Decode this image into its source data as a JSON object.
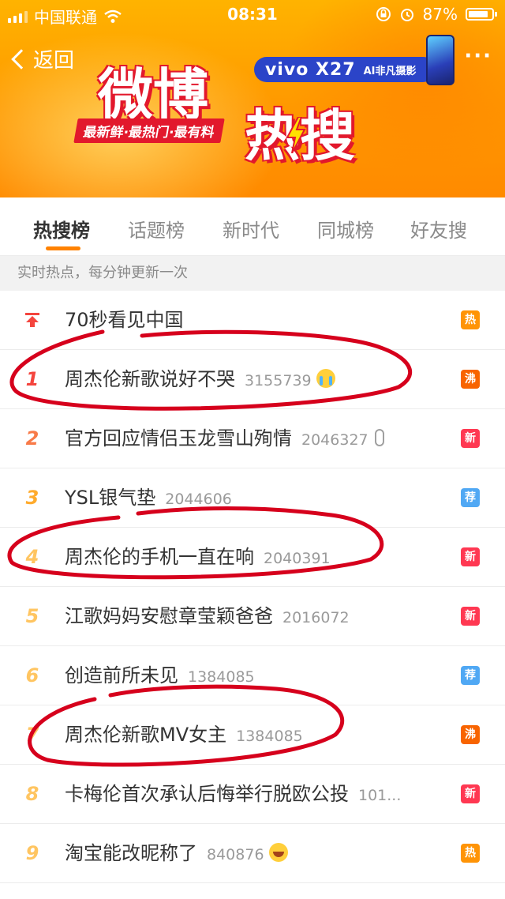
{
  "status_bar": {
    "carrier": "中国联通",
    "time": "08:31",
    "battery": "87%",
    "battery_level": 0.87
  },
  "nav": {
    "back_label": "返回",
    "more_label": "···"
  },
  "banner": {
    "logo_part1": "微博",
    "logo_part2": "热搜",
    "slogan": "最新鲜·最热门·最有料",
    "ad_brand": "vivo X27",
    "ad_tag": "AI非凡摄影"
  },
  "tabs": [
    {
      "label": "热搜榜",
      "active": true
    },
    {
      "label": "话题榜",
      "active": false
    },
    {
      "label": "新时代",
      "active": false
    },
    {
      "label": "同城榜",
      "active": false
    },
    {
      "label": "好友搜",
      "active": false
    }
  ],
  "subheader": "实时热点，每分钟更新一次",
  "list": [
    {
      "rank": "",
      "title": "70秒看见中国",
      "count": "",
      "extra": "",
      "badge": "热",
      "badge_type": "hot"
    },
    {
      "rank": "1",
      "title": "周杰伦新歌说好不哭",
      "count": "3155739",
      "extra": "crying-face",
      "badge": "沸",
      "badge_type": "boil"
    },
    {
      "rank": "2",
      "title": "官方回应情侣玉龙雪山殉情",
      "count": "2046327",
      "extra": "microphone",
      "badge": "新",
      "badge_type": "new"
    },
    {
      "rank": "3",
      "title": "YSL银气垫",
      "count": "2044606",
      "extra": "",
      "badge": "荐",
      "badge_type": "rec"
    },
    {
      "rank": "4",
      "title": "周杰伦的手机一直在响",
      "count": "2040391",
      "extra": "",
      "badge": "新",
      "badge_type": "new"
    },
    {
      "rank": "5",
      "title": "江歌妈妈安慰章莹颖爸爸",
      "count": "2016072",
      "extra": "",
      "badge": "新",
      "badge_type": "new"
    },
    {
      "rank": "6",
      "title": "创造前所未见",
      "count": "1384085",
      "extra": "",
      "badge": "荐",
      "badge_type": "rec"
    },
    {
      "rank": "7",
      "title": "周杰伦新歌MV女主",
      "count": "1384085",
      "extra": "",
      "badge": "沸",
      "badge_type": "boil"
    },
    {
      "rank": "8",
      "title": "卡梅伦首次承认后悔举行脱欧公投",
      "count": "101...",
      "extra": "",
      "badge": "新",
      "badge_type": "new"
    },
    {
      "rank": "9",
      "title": "淘宝能改昵称了",
      "count": "840876",
      "extra": "laughing-face",
      "badge": "热",
      "badge_type": "hot"
    }
  ],
  "colors": {
    "accent": "#ff8200",
    "annotation": "#d6001c"
  }
}
